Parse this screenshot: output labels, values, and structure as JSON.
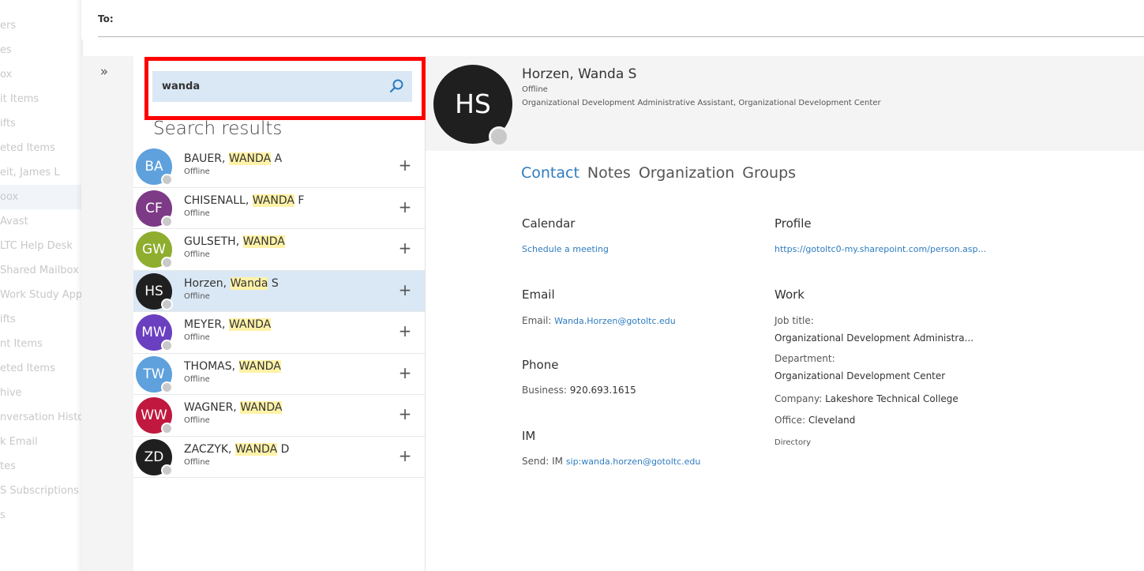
{
  "folders": [
    {
      "label": "ers",
      "active": false
    },
    {
      "label": "es",
      "active": false
    },
    {
      "label": "ox",
      "active": false
    },
    {
      "label": "it Items",
      "active": false
    },
    {
      "label": "ifts",
      "active": false
    },
    {
      "label": "eted Items",
      "active": false
    },
    {
      "label": "eit, James L",
      "active": false
    },
    {
      "label": "oox",
      "active": true
    },
    {
      "label": "Avast",
      "active": false
    },
    {
      "label": "LTC Help Desk",
      "active": false
    },
    {
      "label": "Shared Mailbox",
      "active": false
    },
    {
      "label": "Work Study App",
      "active": false
    },
    {
      "label": "ifts",
      "active": false
    },
    {
      "label": "nt Items",
      "active": false
    },
    {
      "label": "eted Items",
      "active": false
    },
    {
      "label": "hive",
      "active": false
    },
    {
      "label": "nversation Histor",
      "active": false
    },
    {
      "label": "k Email",
      "active": false
    },
    {
      "label": "tes",
      "active": false
    },
    {
      "label": "S Subscriptions",
      "active": false
    },
    {
      "label": "s",
      "active": false
    }
  ],
  "compose": {
    "to_label": "To:"
  },
  "collapse": {
    "expand_label": "»"
  },
  "search": {
    "value": "wanda",
    "placeholder": "",
    "icon": "search-icon",
    "results_title": "Search results"
  },
  "results": [
    {
      "initials": "BA",
      "color": "#5ea1dd",
      "pre": "BAUER, ",
      "match": "WANDA",
      "post": " A",
      "status": "Offline",
      "selected": false
    },
    {
      "initials": "CF",
      "color": "#7d3a86",
      "pre": "CHISENALL, ",
      "match": "WANDA",
      "post": " F",
      "status": "Offline",
      "selected": false
    },
    {
      "initials": "GW",
      "color": "#8fad2e",
      "pre": "GULSETH, ",
      "match": "WANDA",
      "post": "",
      "status": "Offline",
      "selected": false
    },
    {
      "initials": "HS",
      "color": "#1f1f1f",
      "pre": "Horzen, ",
      "match": "Wanda",
      "post": " S",
      "status": "Offline",
      "selected": true
    },
    {
      "initials": "MW",
      "color": "#6a3fc0",
      "pre": "MEYER, ",
      "match": "WANDA",
      "post": "",
      "status": "Offline",
      "selected": false
    },
    {
      "initials": "TW",
      "color": "#5ea1dd",
      "pre": "THOMAS, ",
      "match": "WANDA",
      "post": "",
      "status": "Offline",
      "selected": false
    },
    {
      "initials": "WW",
      "color": "#c0183e",
      "pre": "WAGNER, ",
      "match": "WANDA",
      "post": "",
      "status": "Offline",
      "selected": false
    },
    {
      "initials": "ZD",
      "color": "#1f1f1f",
      "pre": "ZACZYK, ",
      "match": "WANDA",
      "post": " D",
      "status": "Offline",
      "selected": false
    }
  ],
  "card": {
    "initials": "HS",
    "name": "Horzen, Wanda S",
    "status": "Offline",
    "title": "Organizational Development Administrative Assistant, Organizational Development Center",
    "tabs": [
      {
        "label": "Contact",
        "active": true
      },
      {
        "label": "Notes",
        "active": false
      },
      {
        "label": "Organization",
        "active": false
      },
      {
        "label": "Groups",
        "active": false
      }
    ],
    "calendar": {
      "heading": "Calendar",
      "link": "Schedule a meeting"
    },
    "email": {
      "heading": "Email",
      "label": "Email:",
      "value": "Wanda.Horzen@gotoltc.edu"
    },
    "phone": {
      "heading": "Phone",
      "label": "Business:",
      "value": "920.693.1615"
    },
    "im": {
      "heading": "IM",
      "label": "Send: IM",
      "value": "sip:wanda.horzen@gotoltc.edu"
    },
    "profile": {
      "heading": "Profile",
      "link": "https://gotoltc0-my.sharepoint.com/person.asp..."
    },
    "work": {
      "heading": "Work",
      "job_title_label": "Job title:",
      "job_title": "Organizational Development Administra...",
      "department_label": "Department:",
      "department": "Organizational Development Center",
      "company_label": "Company:",
      "company": "Lakeshore Technical College",
      "office_label": "Office:",
      "office": "Cleveland",
      "directory": "Directory"
    }
  }
}
